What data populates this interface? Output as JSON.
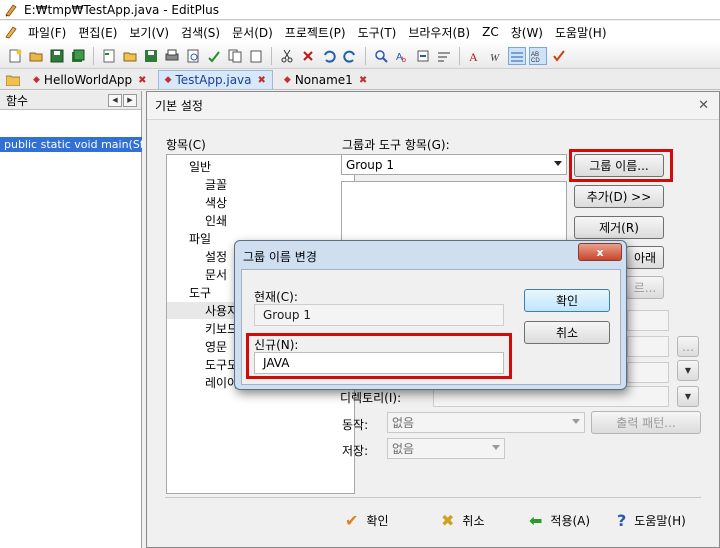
{
  "window": {
    "title": "E:₩tmp₩TestApp.java - EditPlus"
  },
  "menu": [
    "파일(F)",
    "편집(E)",
    "보기(V)",
    "검색(S)",
    "문서(D)",
    "프로젝트(P)",
    "도구(T)",
    "브라우저(B)",
    "ZC",
    "창(W)",
    "도움말(H)"
  ],
  "toolbar_icons": [
    "new-icon",
    "open-icon",
    "save-icon",
    "save-all-icon",
    "new-file-icon",
    "open-folder-icon",
    "save-as-icon",
    "print-icon",
    "print-preview-icon",
    "spellcheck-icon",
    "copy-icon",
    "paste-icon",
    "cut-icon",
    "delete-icon",
    "undo-icon",
    "redo-icon",
    "find-icon",
    "replace-icon",
    "goto-icon",
    "word-wrap-icon",
    "font-icon",
    "column-icon",
    "hex-icon",
    "check-icon"
  ],
  "tabs": [
    {
      "label": "HelloWorldApp",
      "selected": false
    },
    {
      "label": "TestApp.java",
      "selected": true
    },
    {
      "label": "Noname1",
      "selected": false
    }
  ],
  "function_panel": {
    "header": "함수",
    "items": [
      "public static void main(Str"
    ]
  },
  "settings_dialog": {
    "title": "기본 설정",
    "category_label": "항목(C)",
    "tree": [
      {
        "label": "일반",
        "level": 1
      },
      {
        "label": "글꼴",
        "level": 2
      },
      {
        "label": "색상",
        "level": 2
      },
      {
        "label": "인쇄",
        "level": 2
      },
      {
        "label": "파일",
        "level": 1
      },
      {
        "label": "설정",
        "level": 2
      },
      {
        "label": "문서",
        "level": 2
      },
      {
        "label": "도구",
        "level": 1
      },
      {
        "label": "사용자",
        "level": 2,
        "selected": true
      },
      {
        "label": "키보드",
        "level": 2
      },
      {
        "label": "영문",
        "level": 2
      },
      {
        "label": "도구모",
        "level": 2
      },
      {
        "label": "레이아",
        "level": 2
      }
    ],
    "group_label": "그룹과 도구 항목(G):",
    "group_value": "Group 1",
    "buttons": {
      "rename": "그룹 이름...",
      "add": "추가(D) >>",
      "remove": "제거(R)",
      "down": "아래",
      "browse_partial": "르..."
    },
    "directory_label": "디렉토리(I):",
    "action_label": "동작:",
    "action_value": "없음",
    "output_pattern": "출력 패턴...",
    "save_label": "저장:",
    "save_value": "없음",
    "footer": {
      "ok": "확인",
      "cancel": "취소",
      "apply": "적용(A)",
      "help": "도움말(H)"
    }
  },
  "rename_dialog": {
    "title": "그룹 이름 변경",
    "current_label": "현재(C):",
    "current_value": "Group 1",
    "new_label": "신규(N):",
    "new_value": "JAVA",
    "ok": "확인",
    "cancel": "취소",
    "close_glyph": "x"
  },
  "colors": {
    "highlight_red": "#d10a0a",
    "selection_blue": "#3170d6",
    "tab_active": "#d6e8fa"
  }
}
